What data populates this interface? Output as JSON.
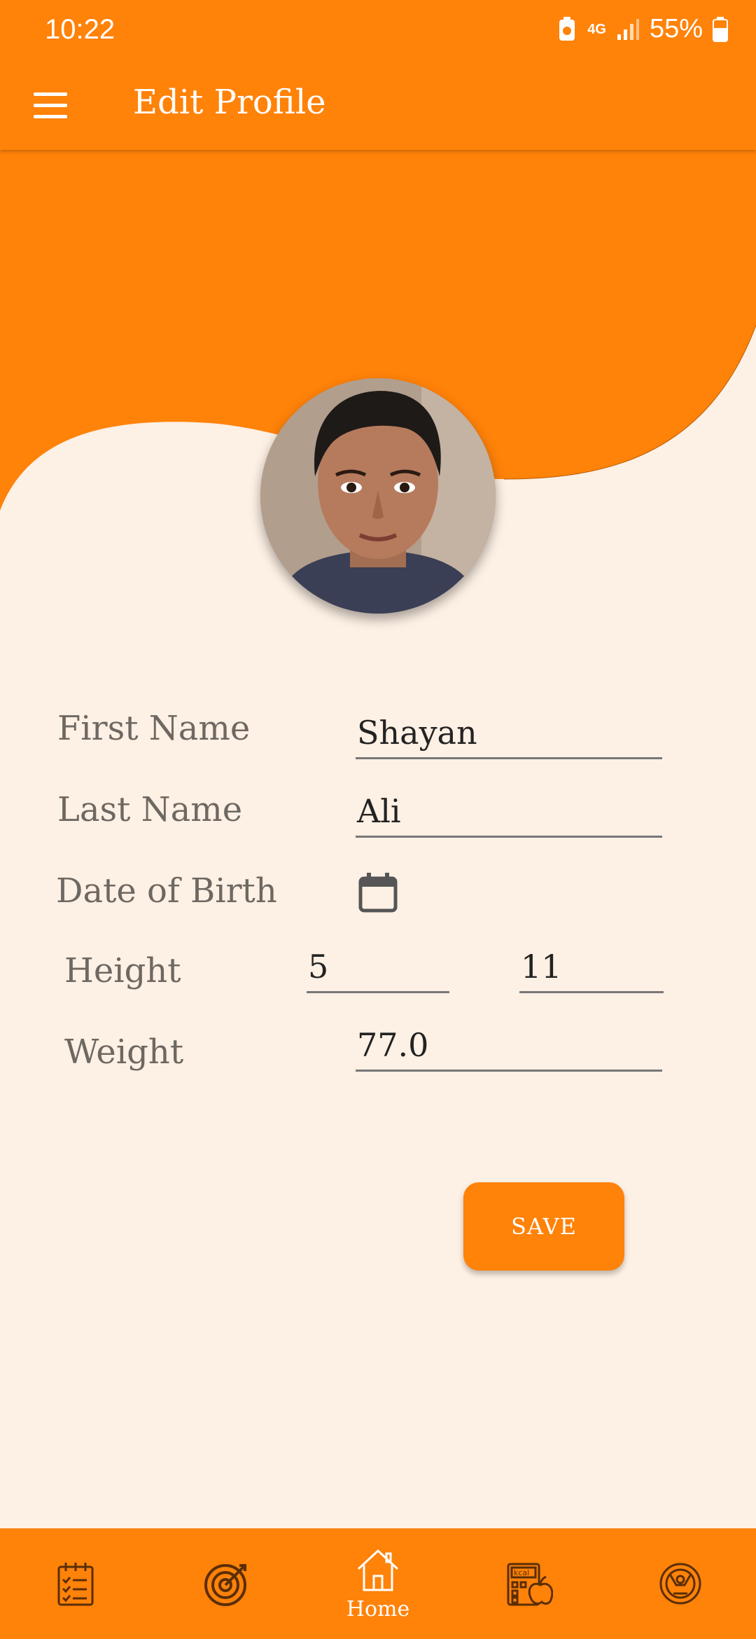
{
  "status_bar": {
    "time": "10:22",
    "network": "4G",
    "battery": "55%"
  },
  "app_bar": {
    "title": "Edit Profile",
    "menu_icon": "hamburger-menu-icon"
  },
  "profile": {
    "avatar_alt": "Profile photo"
  },
  "form": {
    "first_name": {
      "label": "First Name",
      "value": "Shayan"
    },
    "last_name": {
      "label": "Last Name",
      "value": "Ali"
    },
    "dob": {
      "label": "Date of Birth",
      "icon": "calendar-icon"
    },
    "height": {
      "label": "Height",
      "feet": "5",
      "inches": "11"
    },
    "weight": {
      "label": "Weight",
      "value": "77.0"
    }
  },
  "save_button": {
    "label": "SAVE"
  },
  "bottom_nav": {
    "items": [
      {
        "icon": "diary-checklist-icon",
        "label": ""
      },
      {
        "icon": "target-goal-icon",
        "label": ""
      },
      {
        "icon": "home-icon",
        "label": "Home"
      },
      {
        "icon": "calorie-calculator-icon",
        "label": ""
      },
      {
        "icon": "fitness-person-icon",
        "label": ""
      }
    ]
  },
  "colors": {
    "primary": "#ff8209",
    "background": "#fdf0e4",
    "label_text": "#6e6862",
    "nav_icon": "#5a2e06"
  }
}
